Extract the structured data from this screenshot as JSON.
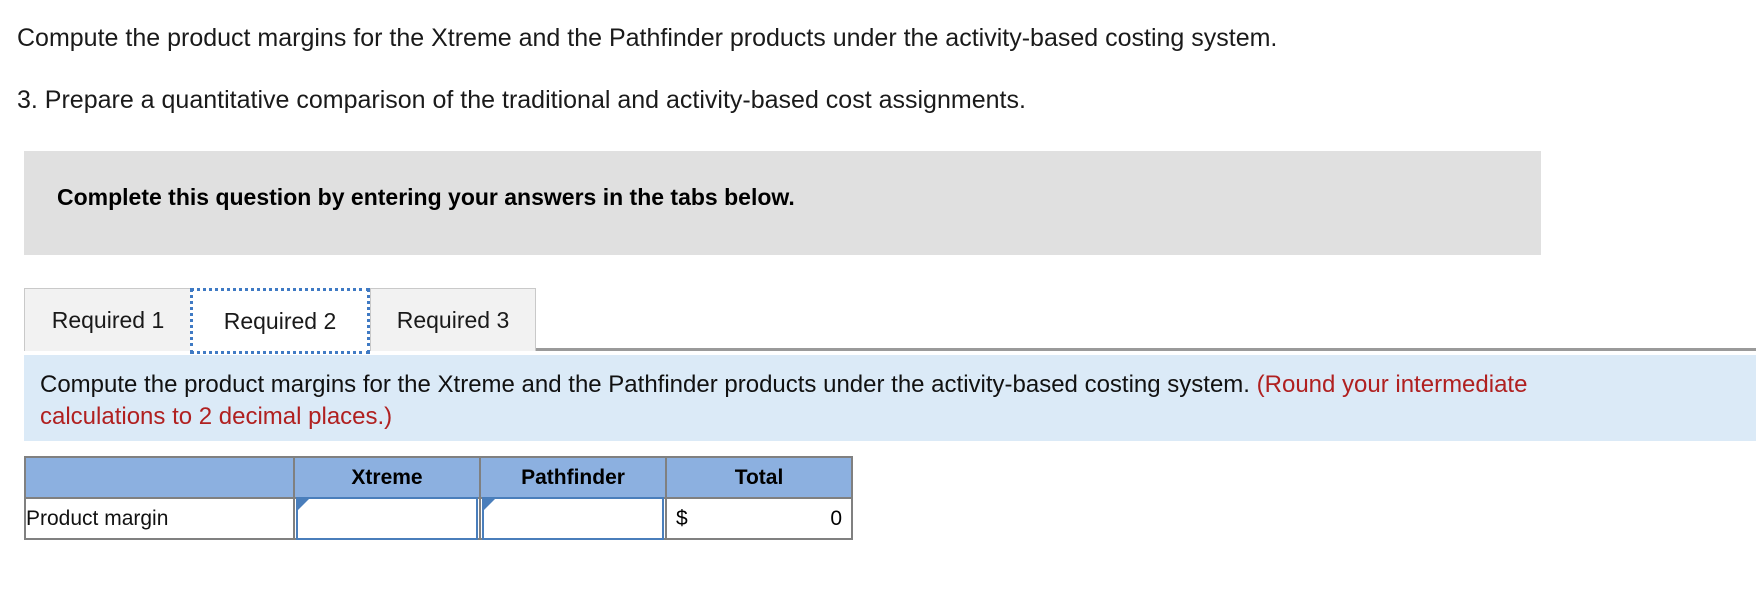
{
  "question": {
    "line1": "Compute the product margins for the Xtreme and the Pathfinder products under the activity-based costing system.",
    "line2": "3. Prepare a quantitative comparison of the traditional and activity-based cost assignments."
  },
  "banner": {
    "text": "Complete this question by entering your answers in the tabs below."
  },
  "tabs": {
    "items": [
      {
        "label": "Required 1",
        "active": false
      },
      {
        "label": "Required 2",
        "active": true
      },
      {
        "label": "Required 3",
        "active": false
      }
    ]
  },
  "instruction": {
    "black_text": "Compute the product margins for the Xtreme and the Pathfinder products under the activity-based costing system. ",
    "red_text": "(Round your intermediate calculations to 2 decimal places.)",
    "red_color": "#b02020",
    "background_color": "#dbeaf7"
  },
  "table": {
    "header_color": "#8cb0e0",
    "headers": [
      "",
      "Xtreme",
      "Pathfinder",
      "Total"
    ],
    "rows": [
      {
        "label": "Product margin",
        "xtreme": "",
        "pathfinder": "",
        "total_currency": "$",
        "total_value": "0"
      }
    ]
  }
}
